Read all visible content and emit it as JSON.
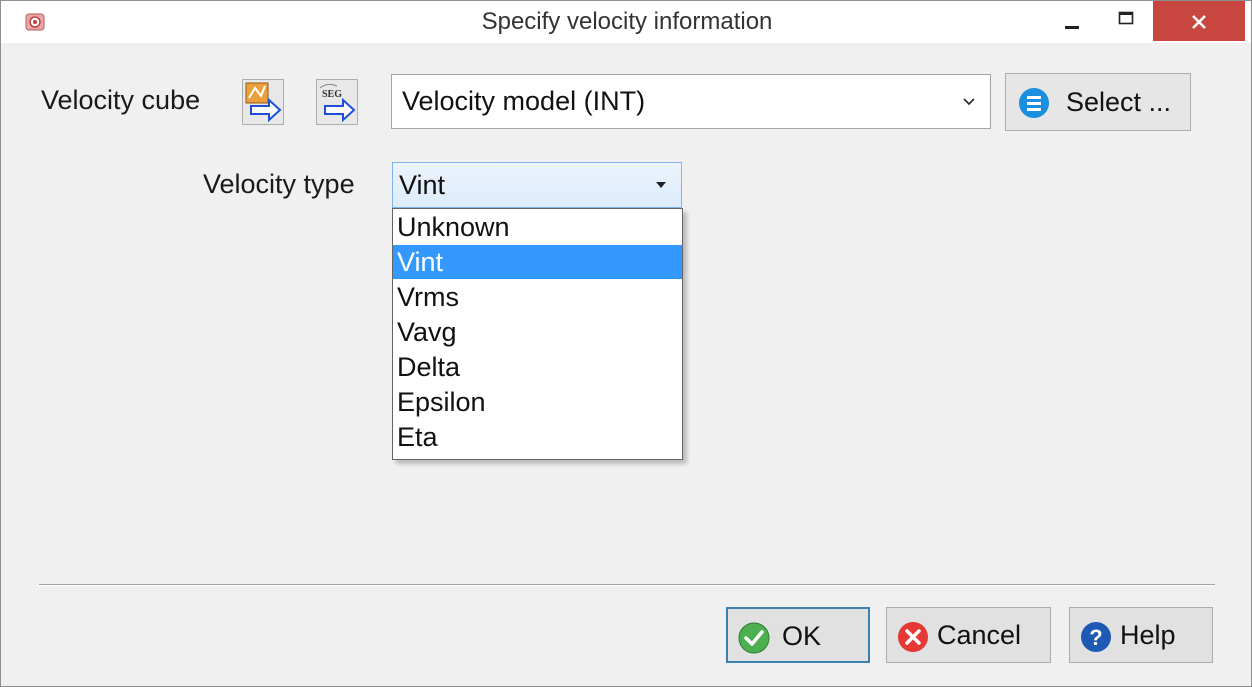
{
  "window": {
    "title": "Specify velocity information"
  },
  "velocity_cube": {
    "label": "Velocity cube",
    "icon_import": "import-arrow-icon",
    "icon_segy": "segy-import-icon",
    "selected": "Velocity model (INT)",
    "select_button": "Select ..."
  },
  "velocity_type": {
    "label": "Velocity type",
    "selected": "Vint",
    "options": [
      "Unknown",
      "Vint",
      "Vrms",
      "Vavg",
      "Delta",
      "Epsilon",
      "Eta"
    ],
    "highlighted": "Vint"
  },
  "buttons": {
    "ok": "OK",
    "cancel": "Cancel",
    "help": "Help"
  },
  "colors": {
    "close_button": "#c7463f",
    "selection": "#3399ff",
    "ok_icon": "#4caf50",
    "cancel_icon": "#e53935",
    "help_icon": "#1e5ab4"
  }
}
